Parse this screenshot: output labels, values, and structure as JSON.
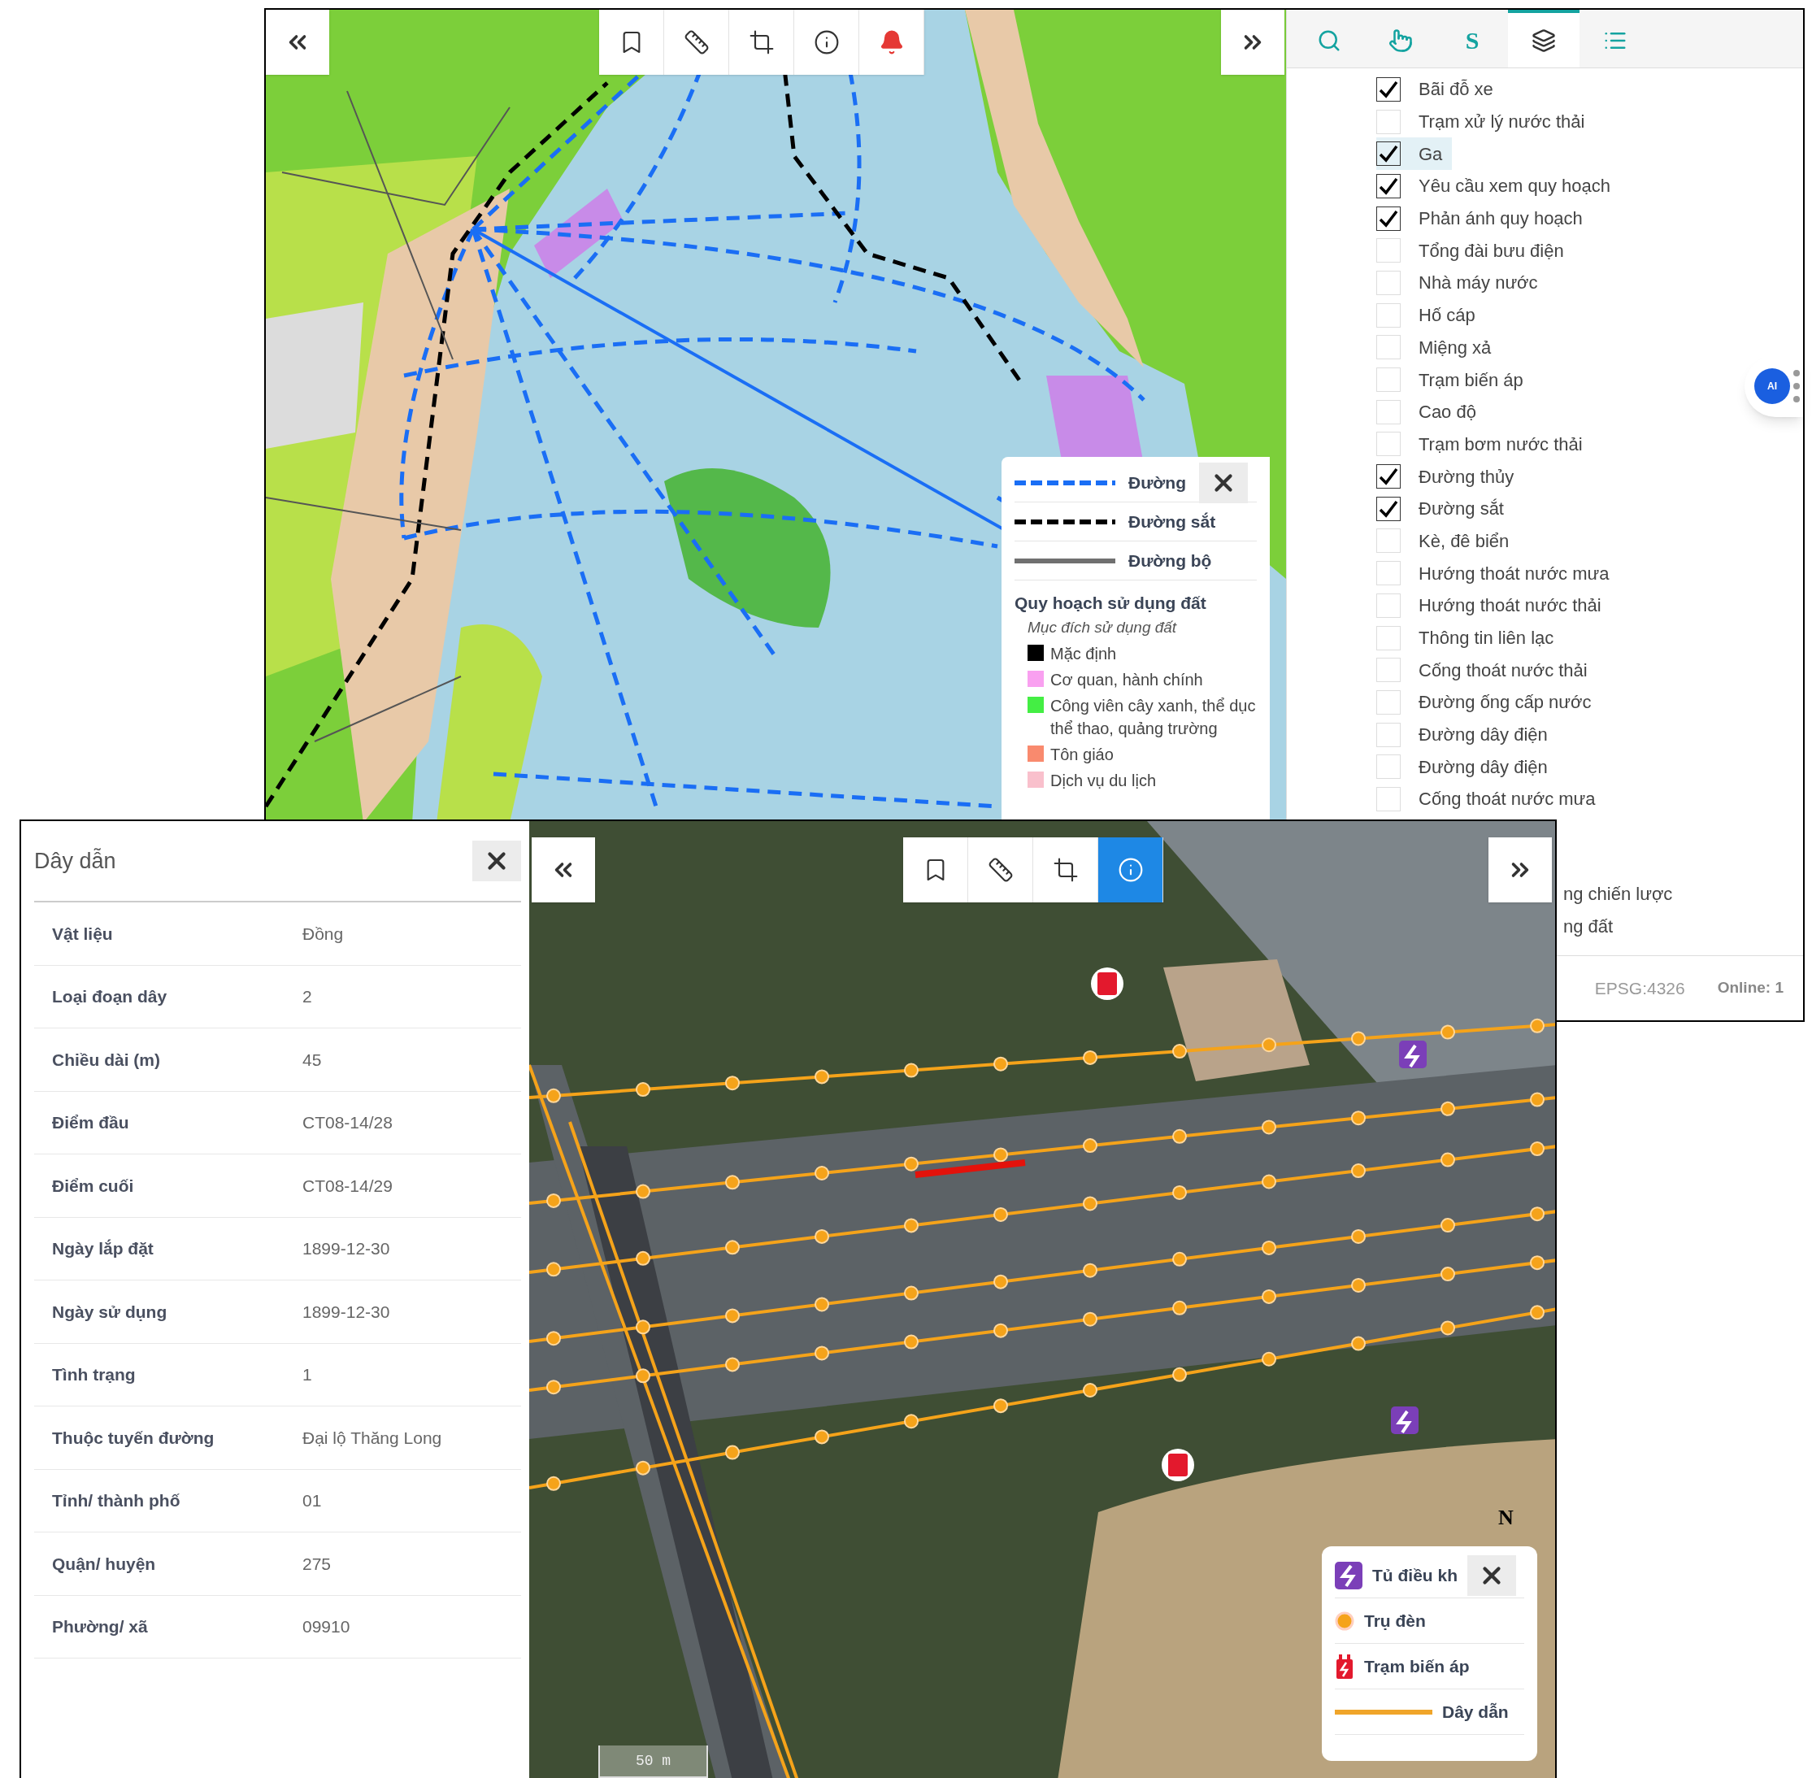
{
  "top_window": {
    "toolbar": {
      "tools": [
        {
          "kind": "bookmark",
          "selected": false
        },
        {
          "kind": "ruler",
          "selected": false
        },
        {
          "kind": "crop",
          "selected": false
        },
        {
          "kind": "info",
          "selected": false
        },
        {
          "kind": "bell",
          "selected": false
        }
      ]
    },
    "legend": {
      "lines": [
        {
          "kind": "dashed",
          "color": "#1a6ef5",
          "label": "Đường"
        },
        {
          "kind": "dashed",
          "color": "#000000",
          "label": "Đường sắt"
        },
        {
          "kind": "solid",
          "color": "#707070",
          "label": "Đường bộ"
        }
      ],
      "title": "Quy hoạch sử dụng đất",
      "subtitle": "Mục đích sử dụng đất",
      "items": [
        {
          "label": "Mặc định",
          "color": "#000000"
        },
        {
          "label": "Cơ quan, hành chính",
          "color": "#f9a0f0"
        },
        {
          "label": "Công viên cây xanh, thể dục thể thao, quảng trường",
          "color": "#44ee44"
        },
        {
          "label": "Tôn giáo",
          "color": "#f98a6e"
        },
        {
          "label": "Dịch vụ du lịch",
          "color": "#f9c0cc"
        }
      ]
    },
    "sidebar": {
      "tabs": [
        {
          "kind": "search",
          "selected": false
        },
        {
          "kind": "hand",
          "selected": false
        },
        {
          "kind": "s",
          "label": "S",
          "selected": false
        },
        {
          "kind": "layers",
          "selected": true
        },
        {
          "kind": "list",
          "selected": false
        }
      ],
      "layers": [
        {
          "label": "Bãi đỗ xe",
          "checked": true,
          "selected": false
        },
        {
          "label": "Trạm xử lý nước thải",
          "checked": false,
          "selected": false
        },
        {
          "label": "Ga",
          "checked": true,
          "selected": true
        },
        {
          "label": "Yêu cầu xem quy hoạch",
          "checked": true,
          "selected": false
        },
        {
          "label": "Phản ánh quy hoạch",
          "checked": true,
          "selected": false
        },
        {
          "label": "Tổng đài bưu điện",
          "checked": false,
          "selected": false
        },
        {
          "label": "Nhà máy nước",
          "checked": false,
          "selected": false
        },
        {
          "label": "Hố cáp",
          "checked": false,
          "selected": false
        },
        {
          "label": "Miệng xả",
          "checked": false,
          "selected": false
        },
        {
          "label": "Trạm biến áp",
          "checked": false,
          "selected": false
        },
        {
          "label": "Cao độ",
          "checked": false,
          "selected": false
        },
        {
          "label": "Trạm bơm nước thải",
          "checked": false,
          "selected": false
        },
        {
          "label": "Đường thủy",
          "checked": true,
          "selected": false
        },
        {
          "label": "Đường sắt",
          "checked": true,
          "selected": false
        },
        {
          "label": "Kè, đê biển",
          "checked": false,
          "selected": false
        },
        {
          "label": "Hướng thoát nước mưa",
          "checked": false,
          "selected": false
        },
        {
          "label": "Hướng thoát nước thải",
          "checked": false,
          "selected": false
        },
        {
          "label": "Thông tin liên lạc",
          "checked": false,
          "selected": false
        },
        {
          "label": "Cống thoát nước thải",
          "checked": false,
          "selected": false
        },
        {
          "label": "Đường ống cấp nước",
          "checked": false,
          "selected": false
        },
        {
          "label": "Đường dây điện",
          "checked": false,
          "selected": false
        },
        {
          "label": "Đường dây điện",
          "checked": false,
          "selected": false
        },
        {
          "label": "Cống thoát nước mưa",
          "checked": false,
          "selected": false
        }
      ],
      "layers_cut": [
        {
          "label": "ng chiến lược"
        },
        {
          "label": "ng đất"
        }
      ],
      "ai_button": {
        "label": "AI"
      }
    },
    "status_bar": {
      "crs": "EPSG:4326",
      "online": "Online: 1"
    }
  },
  "bottom_window": {
    "panel": {
      "title": "Dây dẫn",
      "rows": [
        {
          "label": "Vật liệu",
          "value": "Đồng"
        },
        {
          "label": "Loại đoạn dây",
          "value": "2"
        },
        {
          "label": "Chiều dài (m)",
          "value": "45"
        },
        {
          "label": "Điểm đầu",
          "value": "CT08-14/28"
        },
        {
          "label": "Điểm cuối",
          "value": "CT08-14/29"
        },
        {
          "label": "Ngày lắp đặt",
          "value": "1899-12-30"
        },
        {
          "label": "Ngày sử dụng",
          "value": "1899-12-30"
        },
        {
          "label": "Tình trạng",
          "value": "1"
        },
        {
          "label": "Thuộc tuyến đường",
          "value": "Đại lộ Thăng Long"
        },
        {
          "label": "Tỉnh/ thành phố",
          "value": "01"
        },
        {
          "label": "Quận/ huyện",
          "value": "275"
        },
        {
          "label": "Phường/ xã",
          "value": "09910"
        }
      ]
    },
    "toolbar": {
      "tools": [
        {
          "kind": "bookmark",
          "selected": false
        },
        {
          "kind": "ruler",
          "selected": false
        },
        {
          "kind": "crop",
          "selected": false
        },
        {
          "kind": "info",
          "selected": true
        }
      ]
    },
    "legend": {
      "items": [
        {
          "kind": "cabinet",
          "label": "Tủ điều kh"
        },
        {
          "kind": "dot",
          "label": "Trụ đèn"
        },
        {
          "kind": "transformer",
          "label": "Trạm biến áp"
        },
        {
          "kind": "line",
          "label": "Dây dẫn"
        }
      ]
    },
    "scale": "50 m",
    "north": "N"
  }
}
